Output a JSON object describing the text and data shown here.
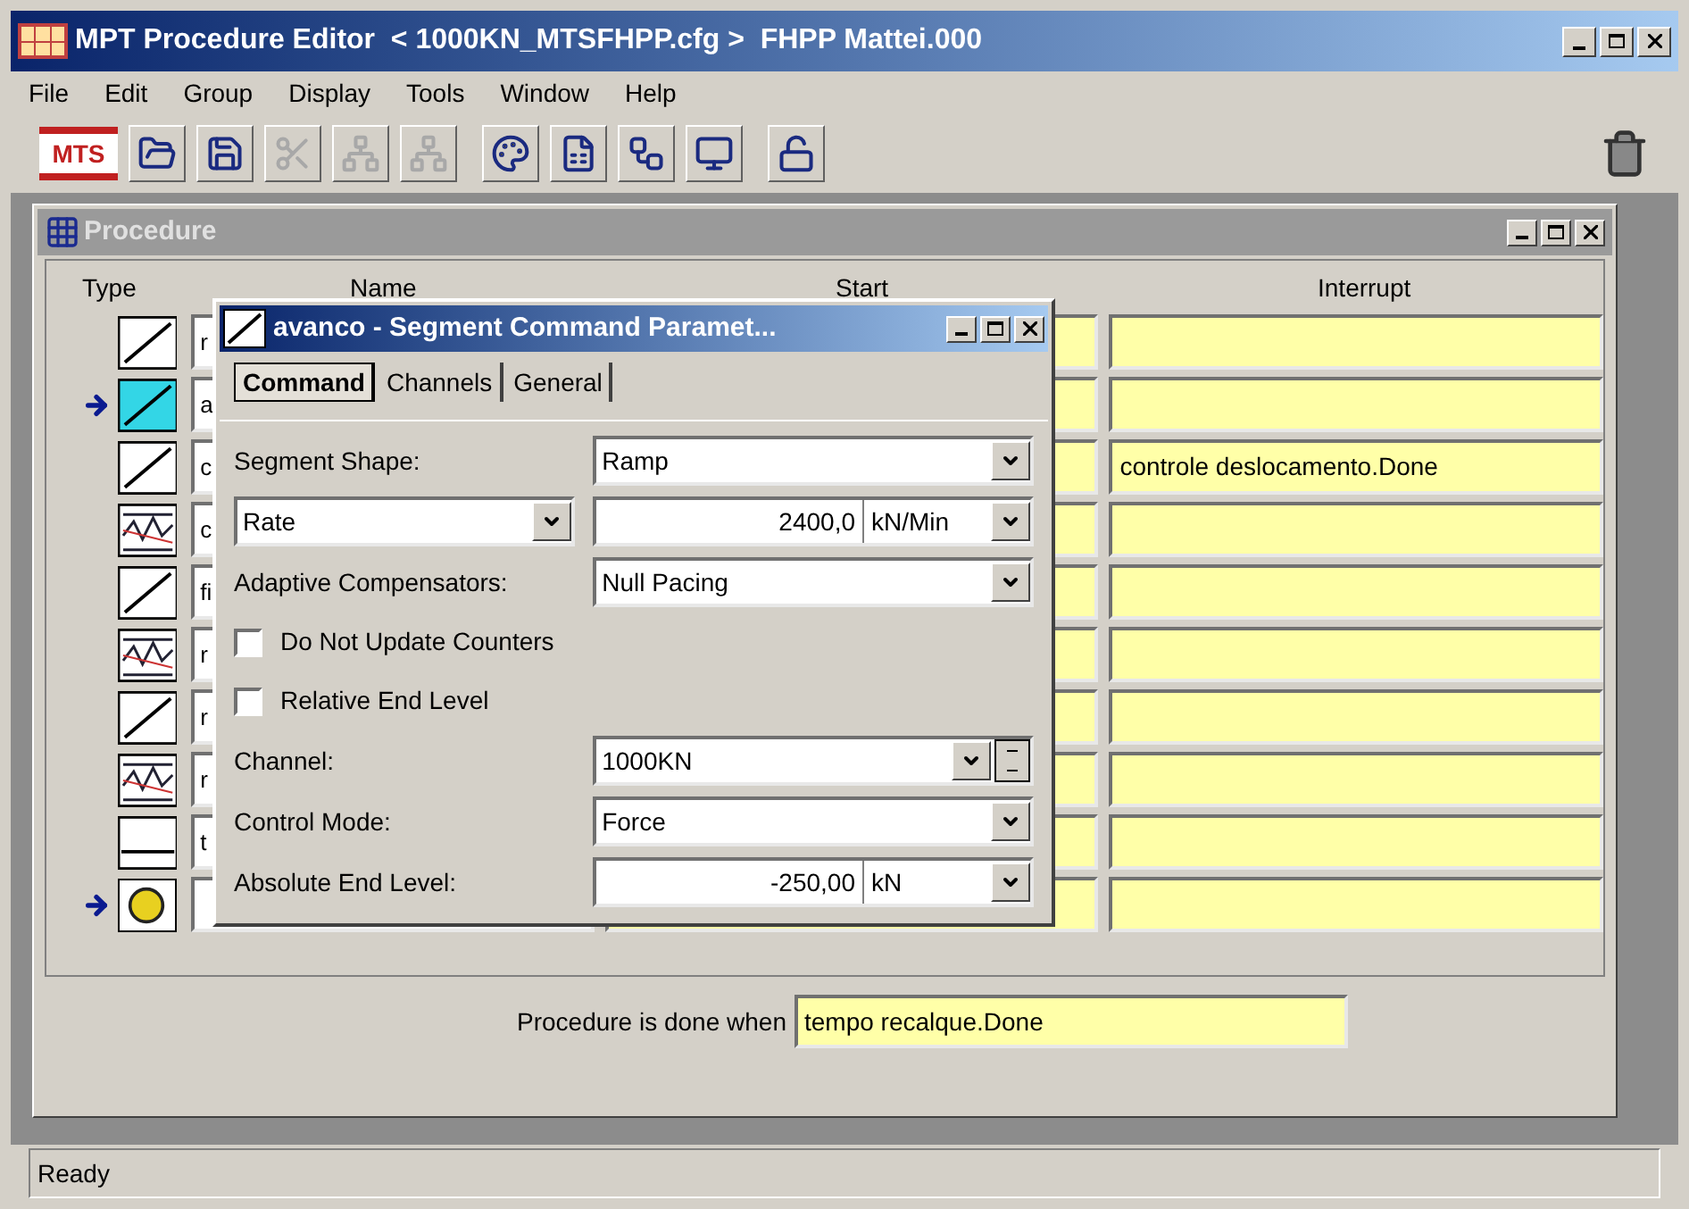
{
  "window": {
    "title": "MPT Procedure Editor  < 1000KN_MTSFHPP.cfg >  FHPP Mattei.000"
  },
  "menu": [
    "File",
    "Edit",
    "Group",
    "Display",
    "Tools",
    "Window",
    "Help"
  ],
  "toolbar": {
    "logo": "MTS",
    "buttons": [
      {
        "kind": "open",
        "disabled": false
      },
      {
        "kind": "save",
        "disabled": false
      },
      {
        "kind": "cut",
        "disabled": true
      },
      {
        "kind": "group",
        "disabled": true
      },
      {
        "kind": "ungroup",
        "disabled": true
      },
      {
        "kind": "palette",
        "disabled": false
      },
      {
        "kind": "chart",
        "disabled": false
      },
      {
        "kind": "channels",
        "disabled": false
      },
      {
        "kind": "monitor",
        "disabled": false
      },
      {
        "kind": "lock",
        "disabled": false
      }
    ]
  },
  "procedure": {
    "title": "Procedure",
    "columns": [
      "Type",
      "Name",
      "Start",
      "Interrupt"
    ],
    "rows": [
      {
        "kind": "ramp",
        "selected": false,
        "current": false,
        "name": "r"
      },
      {
        "kind": "ramp",
        "selected": true,
        "current": true,
        "name": "a"
      },
      {
        "kind": "ramp",
        "selected": false,
        "current": false,
        "name": "c",
        "interrupt": "controle deslocamento.Done"
      },
      {
        "kind": "profile",
        "selected": false,
        "current": false,
        "name": "c"
      },
      {
        "kind": "ramp",
        "selected": false,
        "current": false,
        "name": "fi"
      },
      {
        "kind": "profile",
        "selected": false,
        "current": false,
        "name": "r"
      },
      {
        "kind": "ramp",
        "selected": false,
        "current": false,
        "name": "r"
      },
      {
        "kind": "profile",
        "selected": false,
        "current": false,
        "name": "r"
      },
      {
        "kind": "hold",
        "selected": false,
        "current": false,
        "name": "t"
      },
      {
        "kind": "timer",
        "selected": false,
        "current": true
      }
    ],
    "done_label": "Procedure is done when",
    "done_value": "tempo recalque.Done"
  },
  "dialog": {
    "title": "avanco - Segment Command Paramet...",
    "tabs": [
      {
        "label": "Command",
        "selected": true
      },
      {
        "label": "Channels",
        "selected": false
      },
      {
        "label": "General",
        "selected": false
      }
    ],
    "fields": [
      {
        "kind": "select",
        "label": "Segment Shape:",
        "value": "Ramp"
      },
      {
        "kind": "rate",
        "selector": "Rate",
        "value": "2400,0",
        "unit": "kN/Min"
      },
      {
        "kind": "select",
        "label": "Adaptive Compensators:",
        "value": "Null Pacing"
      },
      {
        "kind": "checkbox",
        "label": "Do Not Update Counters",
        "checked": false
      },
      {
        "kind": "checkbox",
        "label": "Relative End Level",
        "checked": false
      },
      {
        "kind": "spin",
        "label": "Channel:",
        "value": "1000KN"
      },
      {
        "kind": "select",
        "label": "Control Mode:",
        "value": "Force"
      },
      {
        "kind": "number",
        "label": "Absolute End Level:",
        "value": "-250,00",
        "unit": "kN"
      }
    ]
  },
  "status_bar": "Ready"
}
